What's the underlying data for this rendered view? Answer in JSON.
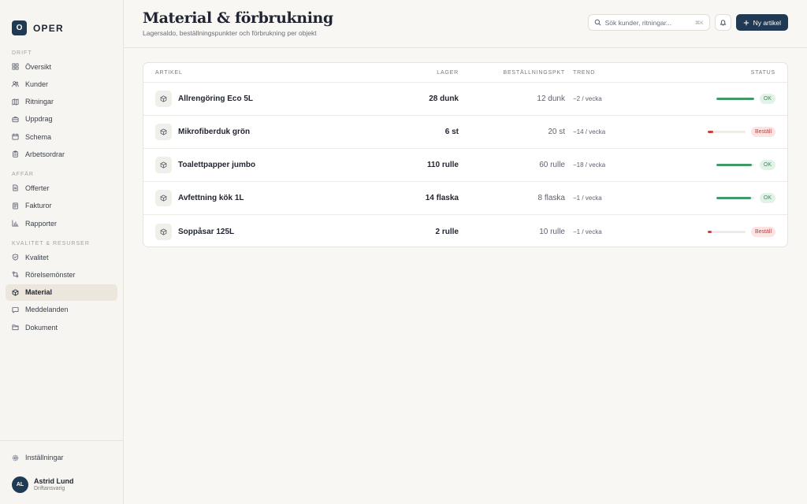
{
  "brand": {
    "logo_letter": "O",
    "name": "OPER"
  },
  "sidebar": {
    "sections": [
      {
        "title": "DRIFT",
        "items": [
          {
            "label": "Översikt",
            "icon": "grid-icon"
          },
          {
            "label": "Kunder",
            "icon": "users-icon"
          },
          {
            "label": "Ritningar",
            "icon": "map-icon"
          },
          {
            "label": "Uppdrag",
            "icon": "briefcase-icon"
          },
          {
            "label": "Schema",
            "icon": "calendar-icon"
          },
          {
            "label": "Arbetsordrar",
            "icon": "clipboard-icon"
          }
        ]
      },
      {
        "title": "AFFÄR",
        "items": [
          {
            "label": "Offerter",
            "icon": "document-icon"
          },
          {
            "label": "Fakturor",
            "icon": "invoice-icon"
          },
          {
            "label": "Rapporter",
            "icon": "chart-icon"
          }
        ]
      },
      {
        "title": "KVALITET & RESURSER",
        "items": [
          {
            "label": "Kvalitet",
            "icon": "shield-icon"
          },
          {
            "label": "Rörelsemönster",
            "icon": "route-icon"
          },
          {
            "label": "Material",
            "icon": "box-icon",
            "active": true
          },
          {
            "label": "Meddelanden",
            "icon": "message-icon"
          },
          {
            "label": "Dokument",
            "icon": "folder-icon"
          }
        ]
      }
    ],
    "settings_label": "Inställningar",
    "user": {
      "initials": "AL",
      "name": "Astrid Lund",
      "role": "Driftansvarig"
    }
  },
  "header": {
    "title": "Material & förbrukning",
    "subtitle": "Lagersaldo, beställningspunkter och förbrukning per objekt",
    "search_placeholder": "Sök kunder, ritningar...",
    "search_shortcut": "⌘K",
    "new_button_label": "Ny artikel"
  },
  "table": {
    "columns": {
      "artikel": "ARTIKEL",
      "lager": "LAGER",
      "best": "BESTÄLLNINGSPKT",
      "trend": "TREND",
      "status": "STATUS"
    },
    "rows": [
      {
        "name": "Allrengöring Eco 5L",
        "lager": "28 dunk",
        "best": "12 dunk",
        "trend": "−2 / vecka",
        "level": 1.0,
        "status": "OK",
        "state": "ok",
        "has_bar": true
      },
      {
        "name": "Mikrofiberduk grön",
        "lager": "6 st",
        "best": "20 st",
        "trend": "−14 / vecka",
        "level": 0.15,
        "status": "Beställ",
        "state": "low",
        "has_bar": true
      },
      {
        "name": "Toalettpapper jumbo",
        "lager": "110 rulle",
        "best": "60 rulle",
        "trend": "−18 / vecka",
        "level": 0.95,
        "status": "OK",
        "state": "ok",
        "has_bar": true
      },
      {
        "name": "Avfettning kök 1L",
        "lager": "14 flaska",
        "best": "8 flaska",
        "trend": "−1 / vecka",
        "level": 0.92,
        "status": "OK",
        "state": "ok",
        "has_bar": true
      },
      {
        "name": "Soppåsar 125L",
        "lager": "2 rulle",
        "best": "10 rulle",
        "trend": "−1 / vecka",
        "level": 0.1,
        "status": "Beställ",
        "state": "low",
        "has_bar": true
      }
    ]
  },
  "colors": {
    "ok": "#3f9a68",
    "low": "#c8403a",
    "brand": "#1f3a52"
  }
}
